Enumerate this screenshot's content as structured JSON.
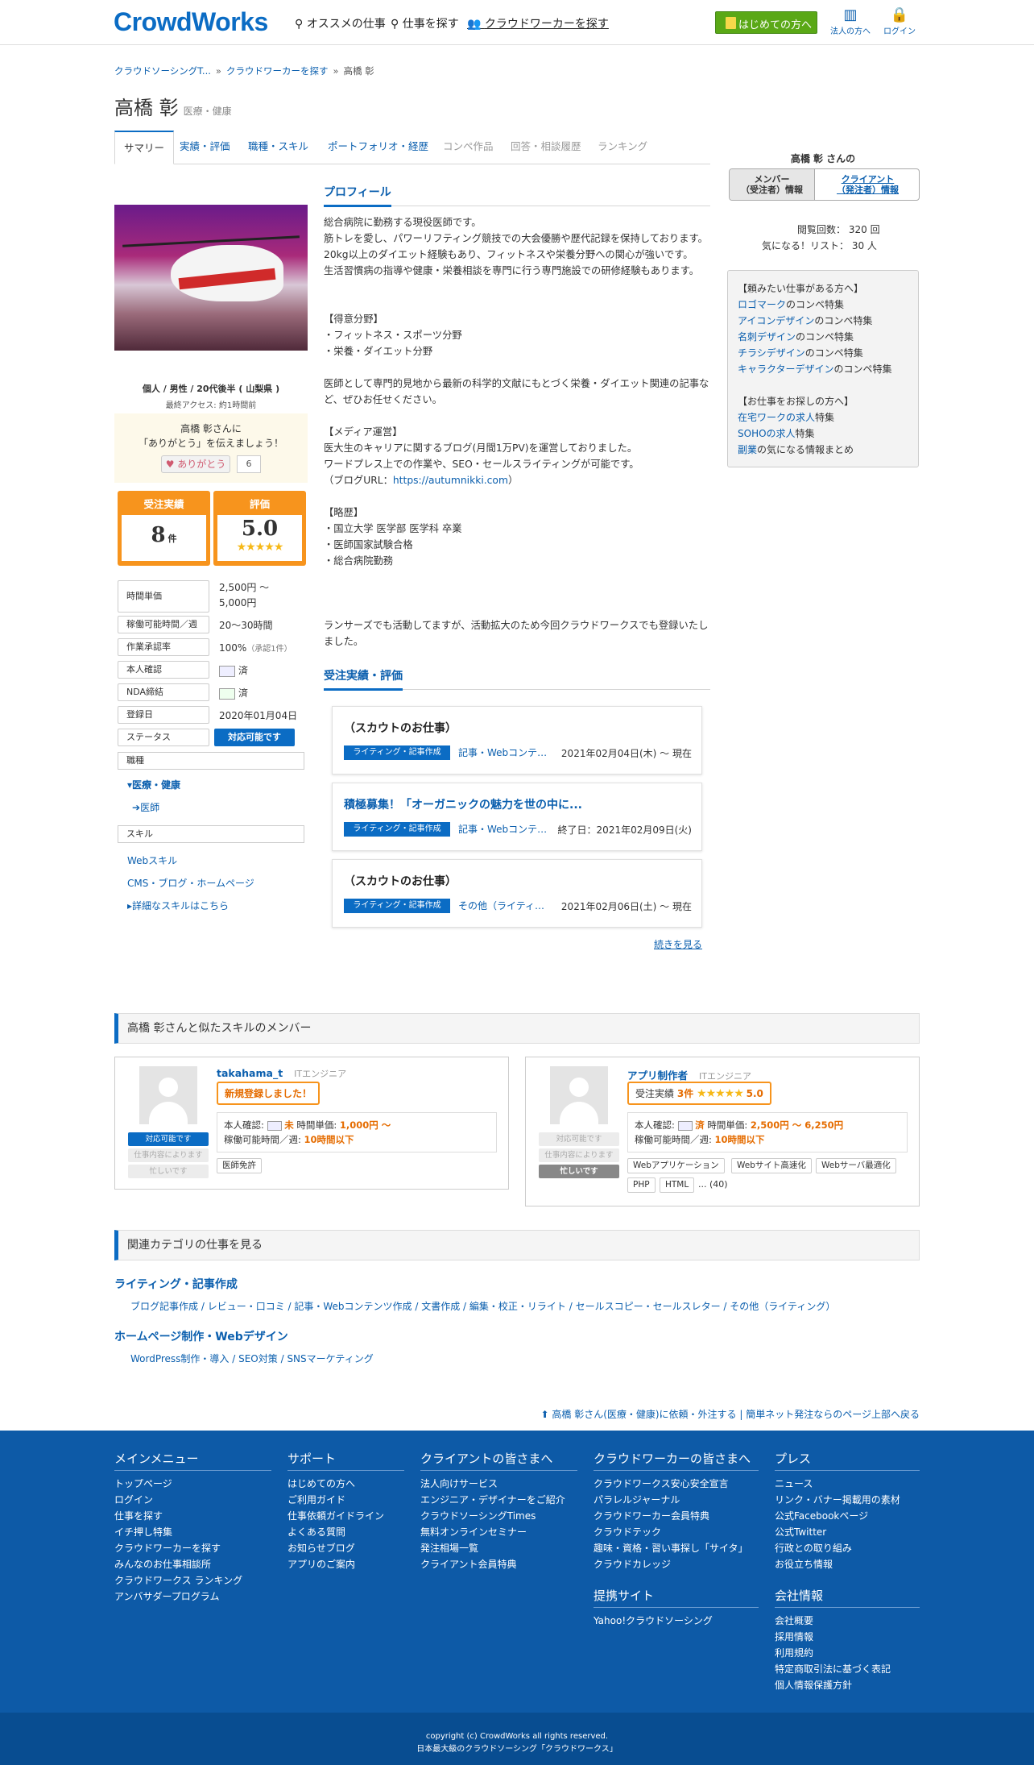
{
  "header": {
    "logo": "CrowdWorks",
    "nav": [
      "オススメの仕事",
      "仕事を探す",
      "クラウドワーカーを探す"
    ],
    "start_btn": "はじめての方へ",
    "corp": "法人の方へ",
    "login": "ログイン"
  },
  "breadcrumb": [
    "クラウドソーシングT...",
    "クラウドワーカーを探す",
    "高橋 彰"
  ],
  "user": {
    "name": "高橋 彰",
    "category": "医療・健康",
    "info": "個人 / 男性 / 20代後半 ( 山梨県 )",
    "last_access": "最終アクセス: 約1時間前",
    "thanks_line1": "高橋 彰さんに",
    "thanks_line2": "「ありがとう」を伝えましょう！",
    "thanks_btn": "ありがとう",
    "thanks_count": "6"
  },
  "tabs": [
    "サマリー",
    "実績・評価",
    "職種・スキル",
    "ポートフォリオ・経歴",
    "コンペ作品",
    "回答・相談履歴",
    "ランキング"
  ],
  "stats": {
    "orders_label": "受注実績",
    "orders_value": "8",
    "orders_unit": "件",
    "rating_label": "評価",
    "rating_value": "5.0",
    "stars": "★★★★★"
  },
  "props": [
    {
      "label": "時間単価",
      "value": "2,500円 〜\n5,000円"
    },
    {
      "label": "稼働可能時間／週",
      "value": "20〜30時間"
    },
    {
      "label": "作業承認率",
      "value": "100%",
      "note": "（承認1件）"
    },
    {
      "label": "本人確認",
      "value": "済"
    },
    {
      "label": "NDA締結",
      "value": "済"
    },
    {
      "label": "登録日",
      "value": "2020年01月04日"
    },
    {
      "label": "ステータス",
      "value": "対応可能です"
    }
  ],
  "job_section": {
    "label": "職種",
    "category": "医療・健康",
    "sub": "医師"
  },
  "skill_section": {
    "label": "スキル",
    "items": [
      "Webスキル",
      "CMS・ブログ・ホームページ"
    ],
    "more": "詳細なスキルはこちら"
  },
  "profile": {
    "heading": "プロフィール",
    "body": "総合病院に勤務する現役医師です。\n筋トレを愛し、パワーリフティング競技での大会優勝や歴代記録を保持しております。\n20kg以上のダイエット経験もあり、フィットネスや栄養分野への関心が強いです。\n生活習慣病の指導や健康・栄養相談を専門に行う専門施設での研修経験もあります。\n\n\n【得意分野】\n・フィットネス・スポーツ分野\n・栄養・ダイエット分野\n\n医師として専門的見地から最新の科学的文献にもとづく栄養・ダイエット関連の記事など、ぜひお任せください。\n\n【メディア運営】\n医大生のキャリアに関するブログ(月間1万PV)を運営しておりました。\nワードプレス上での作業や、SEO・セールスライティングが可能です。\n（ブログURL：",
    "url": "https://autumnikki.com",
    "body2": "）\n\n【略歴】\n・国立大学 医学部 医学科 卒業\n・医師国家試験合格\n・総合病院勤務\n\n\n\nランサーズでも活動してますが、活動拡大のため今回クラウドワークスでも登録いたしました。"
  },
  "works": {
    "heading": "受注実績・評価",
    "items": [
      {
        "title": "（スカウトのお仕事）",
        "tag": "ライティング・記事作成",
        "cat": "記事・Webコンテ…",
        "date": "2021年02月04日(木) 〜 現在",
        "link": false
      },
      {
        "title": "積極募集！「オーガニックの魅力を世の中に...",
        "tag": "ライティング・記事作成",
        "cat": "記事・Webコンテ…",
        "date": "終了日：2021年02月09日(火)",
        "link": true
      },
      {
        "title": "（スカウトのお仕事）",
        "tag": "ライティング・記事作成",
        "cat": "その他（ライティ…",
        "date": "2021年02月06日(土) 〜 現在",
        "link": false
      }
    ],
    "more": "続きを見る"
  },
  "right": {
    "title": "高橋 彰 さんの",
    "tab1": "メンバー\n（受注者）情報",
    "tab2": "クライアント\n（発注者）情報",
    "views_label": "閲覧回数：",
    "views": "320 回",
    "fav_label": "気になる！リスト：",
    "fav": "30 人",
    "box_h1": "【頼みたい仕事がある方へ】",
    "box_links1": [
      [
        "ロゴマーク",
        "のコンペ特集"
      ],
      [
        "アイコンデザイン",
        "のコンペ特集"
      ],
      [
        "名刺デザイン",
        "のコンペ特集"
      ],
      [
        "チラシデザイン",
        "のコンペ特集"
      ],
      [
        "キャラクターデザイン",
        "のコンペ特集"
      ]
    ],
    "box_h2": "【お仕事をお探しの方へ】",
    "box_links2": [
      [
        "在宅ワークの求人",
        "特集"
      ],
      [
        "SOHOの求人",
        "特集"
      ],
      [
        "副業",
        "の気になる情報まとめ"
      ]
    ]
  },
  "similar": {
    "heading": "高橋 彰さんと似たスキルのメンバー",
    "m1": {
      "name": "takahama_t",
      "job": "ITエンジニア",
      "badge": "新規登録しました！",
      "s1": "対応可能です",
      "s2": "仕事内容によります",
      "s3": "忙しいです",
      "id_label": "本人確認:",
      "id_val": "未",
      "rate_label": "時間単価:",
      "rate": "1,000円 〜",
      "hours_label": "稼働可能時間／週:",
      "hours": "10時間以下",
      "chips": [
        "医師免許"
      ]
    },
    "m2": {
      "name": "アプリ制作者",
      "job": "ITエンジニア",
      "orders_label": "受注実績",
      "orders": "3件",
      "stars": "★★★★★",
      "rating": "5.0",
      "s1": "対応可能です",
      "s2": "仕事内容によります",
      "s3": "忙しいです",
      "id_label": "本人確認:",
      "id_val": "済",
      "rate_label": "時間単価:",
      "rate": "2,500円 〜 6,250円",
      "hours_label": "稼働可能時間／週:",
      "hours": "10時間以下",
      "chips": [
        "Webアプリケーション",
        "Webサイト高速化",
        "Webサーバ最適化",
        "PHP",
        "HTML"
      ],
      "more": "... (40)"
    }
  },
  "related": {
    "heading": "関連カテゴリの仕事を見る",
    "cat1": "ライティング・記事作成",
    "links1": [
      "ブログ記事作成",
      "レビュー・口コミ",
      "記事・Webコンテンツ作成",
      "文書作成",
      "編集・校正・リライト",
      "セールスコピー・セールスレター",
      "その他（ライティング）"
    ],
    "cat2": "ホームページ制作・Webデザイン",
    "links2": [
      "WordPress制作・導入",
      "SEO対策",
      "SNSマーケティング"
    ]
  },
  "totop": {
    "text1": "高橋 彰さん(医療・健康)に依頼・外注する",
    "text2": "簡単ネット発注ならのページ上部へ戻る"
  },
  "footer": {
    "cols": [
      {
        "h": "メインメニュー",
        "items": [
          "トップページ",
          "ログイン",
          "仕事を探す",
          "イチ押し特集",
          "クラウドワーカーを探す",
          "みんなのお仕事相談所",
          "クラウドワークス ランキング",
          "アンバサダープログラム"
        ]
      },
      {
        "h": "サポート",
        "items": [
          "はじめての方へ",
          "ご利用ガイド",
          "仕事依頼ガイドライン",
          "よくある質問",
          "お知らせブログ",
          "アプリのご案内"
        ]
      },
      {
        "h": "クライアントの皆さまへ",
        "items": [
          "法人向けサービス",
          "エンジニア・デザイナーをご紹介",
          "クラウドソーシングTimes",
          "無料オンラインセミナー",
          "発注相場一覧",
          "クライアント会員特典"
        ]
      },
      {
        "h": "クラウドワーカーの皆さまへ",
        "items": [
          "クラウドワークス安心安全宣言",
          "パラレルジャーナル",
          "クラウドワーカー会員特典",
          "クラウドテック",
          "趣味・資格・習い事探し「サイタ」",
          "クラウドカレッジ"
        ]
      },
      {
        "h": "提携サイト",
        "items": [
          "Yahoo!クラウドソーシング"
        ]
      },
      {
        "h": "プレス",
        "items": [
          "ニュース",
          "リンク・バナー掲載用の素材",
          "公式Facebookページ",
          "公式Twitter",
          "行政との取り組み",
          "お役立ち情報"
        ]
      },
      {
        "h": "会社情報",
        "items": [
          "会社概要",
          "採用情報",
          "利用規約",
          "特定商取引法に基づく表記",
          "個人情報保護方針"
        ]
      }
    ],
    "copyright": "copyright (c) CrowdWorks all rights reserved.",
    "tagline": "日本最大級のクラウドソーシング「クラウドワークス」"
  },
  "colors": {
    "brand": "#0b6cc4",
    "orange": "#f7941d",
    "footer": "#0d5aa7",
    "green": "#5aa816"
  }
}
